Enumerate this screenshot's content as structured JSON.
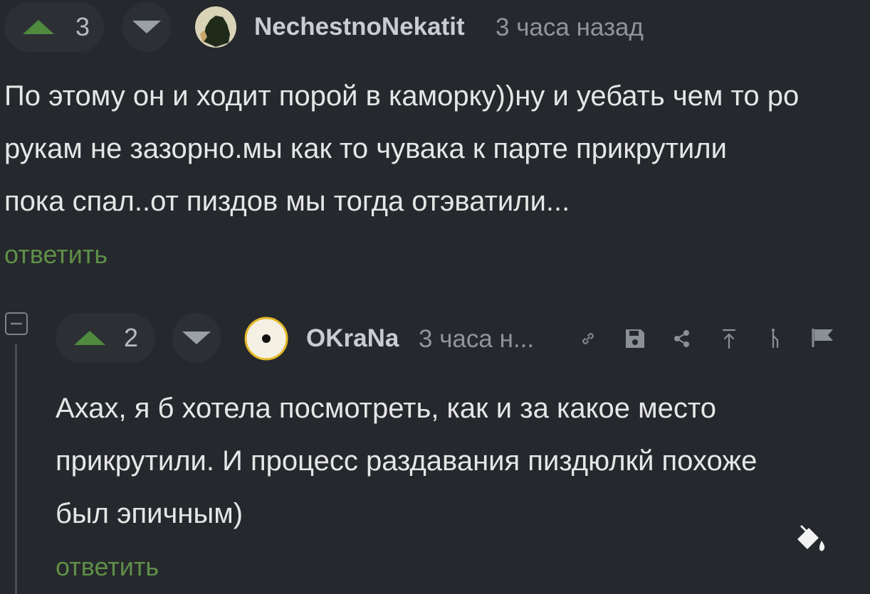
{
  "colors": {
    "background": "#25282c",
    "upvote": "#4f8a3f",
    "reply_link": "#5f8f48",
    "username": "#c9ccd0",
    "timestamp": "#8f959b"
  },
  "comment1": {
    "rating": "3",
    "username": "NechestnoNekatit",
    "time": "3 часа назад",
    "lines": [
      "По этому он и ходит порой в каморку))ну и уебать чем то ро",
      "рукам не зазорно.мы как то чувака к парте прикрутили",
      "пока спал..от пиздов мы тогда отэватили..."
    ],
    "reply_label": "ответить"
  },
  "comment2": {
    "rating": "2",
    "username": "OKraNa",
    "time": "3 часа н...",
    "lines": [
      "Ахах, я б хотела посмотреть, как и за какое место",
      "прикрутили. И процесс раздавания пиздюлкй похоже",
      "был эпичным)"
    ],
    "reply_label": "ответить",
    "toolbar": [
      "link-icon",
      "save-icon",
      "share-icon",
      "scroll-top-icon",
      "branch-icon",
      "flag-icon"
    ]
  },
  "collapse_icon": "minus-square-icon",
  "theme_icon": "paint-bucket-icon"
}
